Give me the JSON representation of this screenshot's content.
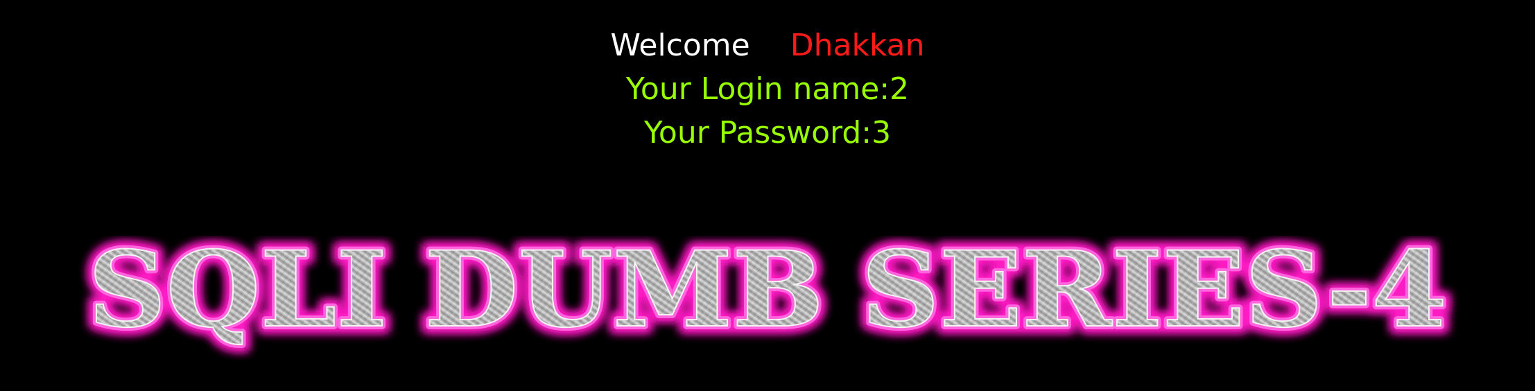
{
  "welcome": {
    "greeting": "Welcome",
    "username": "Dhakkan"
  },
  "login": {
    "name_line": "Your Login name:2",
    "password_line": "Your Password:3"
  },
  "banner": {
    "title": "SQLI DUMB SERIES-4"
  },
  "colors": {
    "background": "#000000",
    "greeting": "#ffffff",
    "username": "#ff1a1a",
    "login_text": "#99ff00",
    "banner_glow": "#ff1fc4",
    "banner_metal": "#a9a9a9"
  }
}
